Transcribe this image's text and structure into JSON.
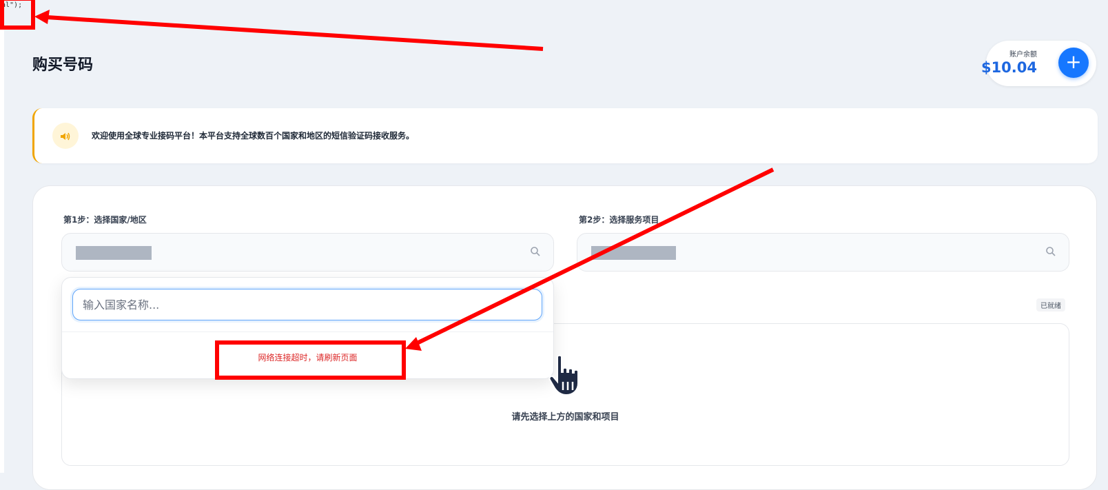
{
  "debug": {
    "text": "al\");"
  },
  "page": {
    "title": "购买号码"
  },
  "balance": {
    "label": "账户余额",
    "amount": "$10.04",
    "add_icon": "plus-icon"
  },
  "notice": {
    "icon": "speaker-icon",
    "text": "欢迎使用全球专业接码平台！本平台支持全球数百个国家和地区的短信验证码接收服务。"
  },
  "steps": {
    "step1_label": "第1步：选择国家/地区",
    "step2_label": "第2步：选择服务项目"
  },
  "country_dropdown": {
    "search_placeholder": "输入国家名称...",
    "error": "网络连接超时，请刷新页面"
  },
  "status": {
    "badge": "已就绪"
  },
  "result": {
    "empty_text": "请先选择上方的国家和项目"
  },
  "colors": {
    "accent": "#1677ff",
    "amount": "#1d67e0",
    "notice_border": "#f0a500",
    "error": "#dc2626",
    "annotation": "#ff0000"
  }
}
